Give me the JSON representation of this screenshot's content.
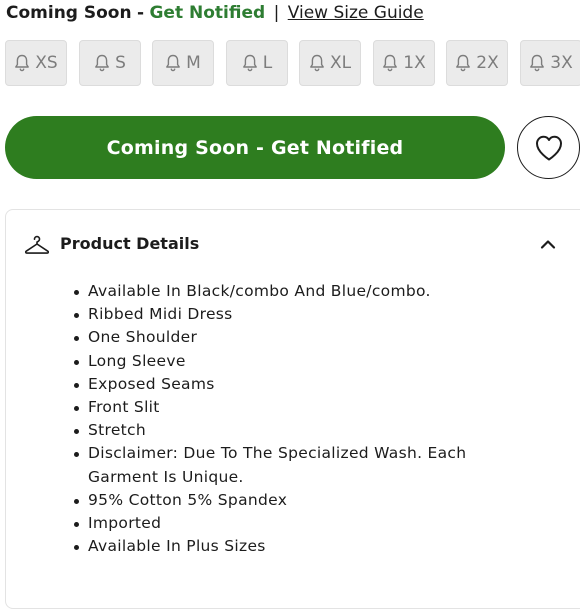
{
  "status": {
    "coming_soon": "Coming Soon",
    "dash": "-",
    "notify": "Get Notified",
    "separator": "|",
    "size_guide": "View Size Guide"
  },
  "sizes": [
    {
      "label": "XS",
      "icon": "bell-icon"
    },
    {
      "label": "S",
      "icon": "bell-icon"
    },
    {
      "label": "M",
      "icon": "bell-icon"
    },
    {
      "label": "L",
      "icon": "bell-icon"
    },
    {
      "label": "XL",
      "icon": "bell-icon"
    },
    {
      "label": "1X",
      "icon": "bell-icon"
    },
    {
      "label": "2X",
      "icon": "bell-icon"
    },
    {
      "label": "3X",
      "icon": "bell-icon"
    }
  ],
  "actions": {
    "notify_button": "Coming Soon - Get Notified",
    "favorite_icon": "heart-icon"
  },
  "details": {
    "title": "Product Details",
    "icon": "hanger-icon",
    "toggle_icon": "chevron-up-icon",
    "items": [
      "Available In Black/combo And Blue/combo.",
      "Ribbed Midi Dress",
      "One Shoulder",
      "Long Sleeve",
      "Exposed Seams",
      "Front Slit",
      "Stretch",
      "Disclaimer: Due To The Specialized Wash. Each Garment Is Unique.",
      "95% Cotton 5% Spandex",
      "Imported",
      "Available In Plus Sizes"
    ]
  },
  "colors": {
    "accent_green": "#2e7d1f",
    "text_green": "#2e7d32",
    "size_bg": "#ebebeb",
    "size_text": "#7d7d7d"
  }
}
